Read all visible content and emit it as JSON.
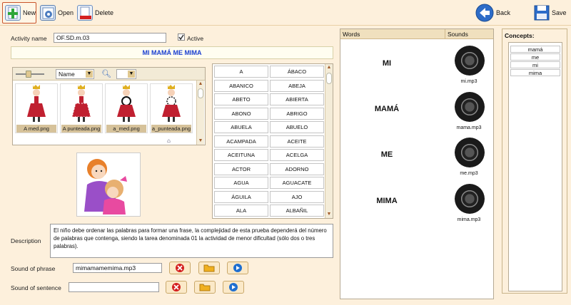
{
  "toolbar": {
    "new_label": "New",
    "open_label": "Open",
    "delete_label": "Delete",
    "back_label": "Back",
    "save_label": "Save"
  },
  "form": {
    "activity_name_label": "Activity name",
    "activity_name_value": "OF.SD.m.03",
    "active_label": "Active",
    "active_checked": true,
    "banner_title": "MI MAMÁ ME MIMA",
    "description_label": "Description",
    "description_text": "El niño debe ordenar las palabras para formar una frase, la complejidad de esta prueba dependerá del número de palabras que contenga, siendo la tarea denominada 01 la actividad de menor dificultad (sólo dos o tres palabras).",
    "sound_phrase_label": "Sound of phrase",
    "sound_phrase_value": "mimamamemima.mp3",
    "sound_sentence_label": "Sound of sentence",
    "sound_sentence_value": ""
  },
  "images": {
    "sort_select": "Name",
    "thumbnails": [
      {
        "label": "A med.png"
      },
      {
        "label": "A punteada.png"
      },
      {
        "label": "a_med.png"
      },
      {
        "label": "a_punteada.png"
      }
    ]
  },
  "wordgrid": {
    "rows": [
      [
        "A",
        "ÁBACO"
      ],
      [
        "ABANICO",
        "ABEJA"
      ],
      [
        "ABETO",
        "ABIERTA"
      ],
      [
        "ABONO",
        "ABRIGO"
      ],
      [
        "ABUELA",
        "ABUELO"
      ],
      [
        "ACAMPADA",
        "ACEITE"
      ],
      [
        "ACEITUNA",
        "ACELGA"
      ],
      [
        "ACTOR",
        "ADORNO"
      ],
      [
        "AGUA",
        "AGUACATE"
      ],
      [
        "ÁGUILA",
        "AJO"
      ],
      [
        "ALA",
        "ALBAÑIL"
      ]
    ]
  },
  "wordsheet": {
    "col_words": "Words",
    "col_sounds": "Sounds",
    "entries": [
      {
        "word": "MI",
        "file": "mi.mp3"
      },
      {
        "word": "MAMÁ",
        "file": "mama.mp3"
      },
      {
        "word": "ME",
        "file": "me.mp3"
      },
      {
        "word": "MIMA",
        "file": "mima.mp3"
      }
    ]
  },
  "concepts": {
    "title": "Concepts:",
    "items": [
      "mamá",
      "me",
      "mi",
      "mima"
    ]
  },
  "colors": {
    "background": "#fdf0dc",
    "banner_text": "#1a3fd0",
    "delete_red": "#d42020",
    "play_blue": "#1f6fd0"
  }
}
